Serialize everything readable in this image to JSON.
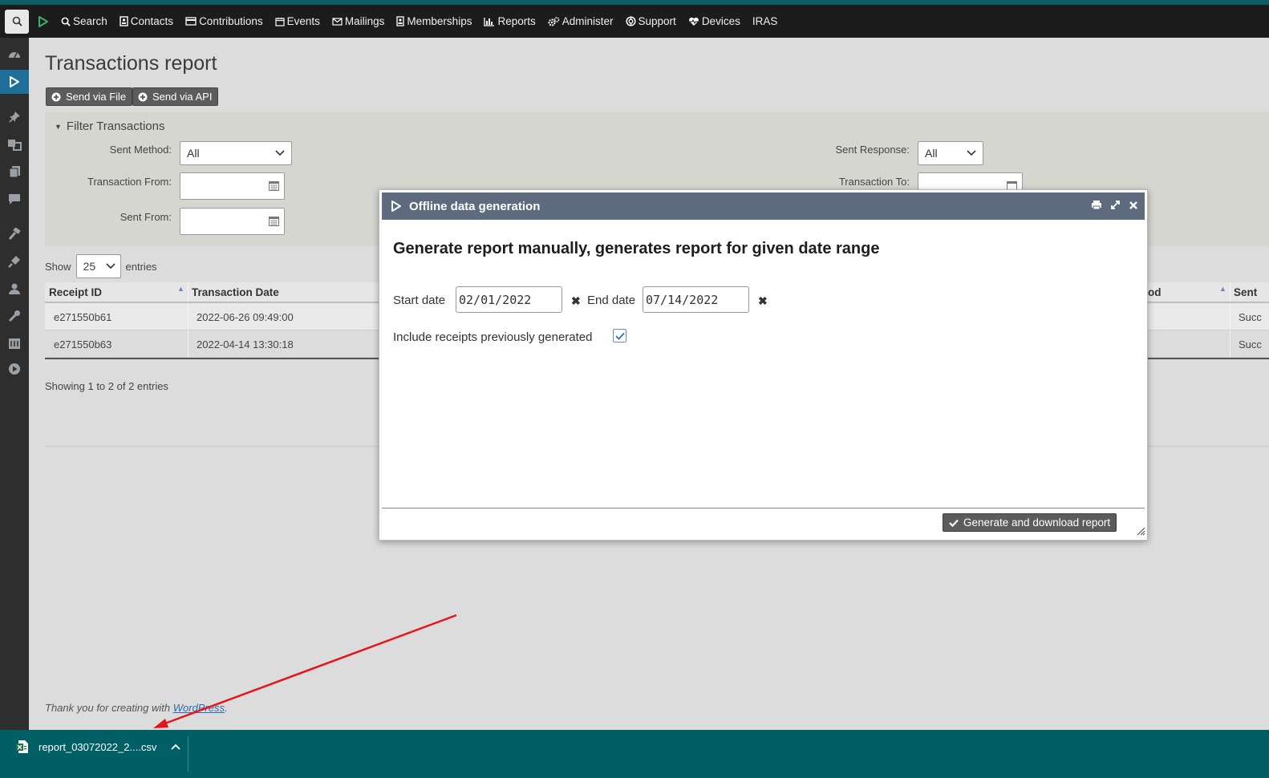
{
  "nav": {
    "items": [
      {
        "label": "Search",
        "icon": "search-icon"
      },
      {
        "label": "Contacts",
        "icon": "contact-card-icon"
      },
      {
        "label": "Contributions",
        "icon": "credit-card-icon"
      },
      {
        "label": "Events",
        "icon": "calendar-icon"
      },
      {
        "label": "Mailings",
        "icon": "envelope-icon"
      },
      {
        "label": "Memberships",
        "icon": "id-badge-icon"
      },
      {
        "label": "Reports",
        "icon": "bar-chart-icon"
      },
      {
        "label": "Administer",
        "icon": "gears-icon"
      },
      {
        "label": "Support",
        "icon": "lifebuoy-icon"
      },
      {
        "label": "Devices",
        "icon": "heartbeat-icon"
      },
      {
        "label": "IRAS",
        "icon": ""
      }
    ]
  },
  "page": {
    "title": "Transactions report",
    "buttons": {
      "send_file": "Send via File",
      "send_api": "Send via API"
    }
  },
  "filter": {
    "title": "Filter Transactions",
    "sent_method_label": "Sent Method:",
    "sent_method_value": "All",
    "transaction_from_label": "Transaction From:",
    "sent_from_label": "Sent From:",
    "sent_response_label": "Sent Response:",
    "sent_response_value": "All",
    "transaction_to_label": "Transaction To:"
  },
  "table": {
    "show_label": "Show",
    "show_value": "25",
    "entries_label": "entries",
    "columns": [
      "Receipt ID",
      "Transaction Date",
      "od",
      "Sent"
    ],
    "rows": [
      {
        "receipt_id": "e271550b61",
        "date": "2022-06-26 09:49:00",
        "sent": "Succ"
      },
      {
        "receipt_id": "e271550b63",
        "date": "2022-04-14 13:30:18",
        "sent": "Succ"
      }
    ],
    "showing": "Showing 1 to 2 of 2 entries"
  },
  "footer": {
    "note_prefix": "Thank you for creating with ",
    "note_link": "WordPress",
    "note_suffix": "."
  },
  "dialog": {
    "title": "Offline data generation",
    "heading": "Generate report manually, generates report for given date range",
    "start_label": "Start date",
    "start_value": "02/01/2022",
    "end_label": "End date",
    "end_value": "07/14/2022",
    "clear_glyph": "✖",
    "include_label": "Include receipts previously generated",
    "include_checked": true,
    "generate_button": "Generate and download report"
  },
  "download_bar": {
    "filename": "report_03072022_2....csv",
    "file_icon": "excel-icon"
  },
  "colors": {
    "navbar": "#1c1c1c",
    "dialog_header": "#5e6a7e",
    "download_bar": "#005f64",
    "arrow": "#e8141b"
  }
}
